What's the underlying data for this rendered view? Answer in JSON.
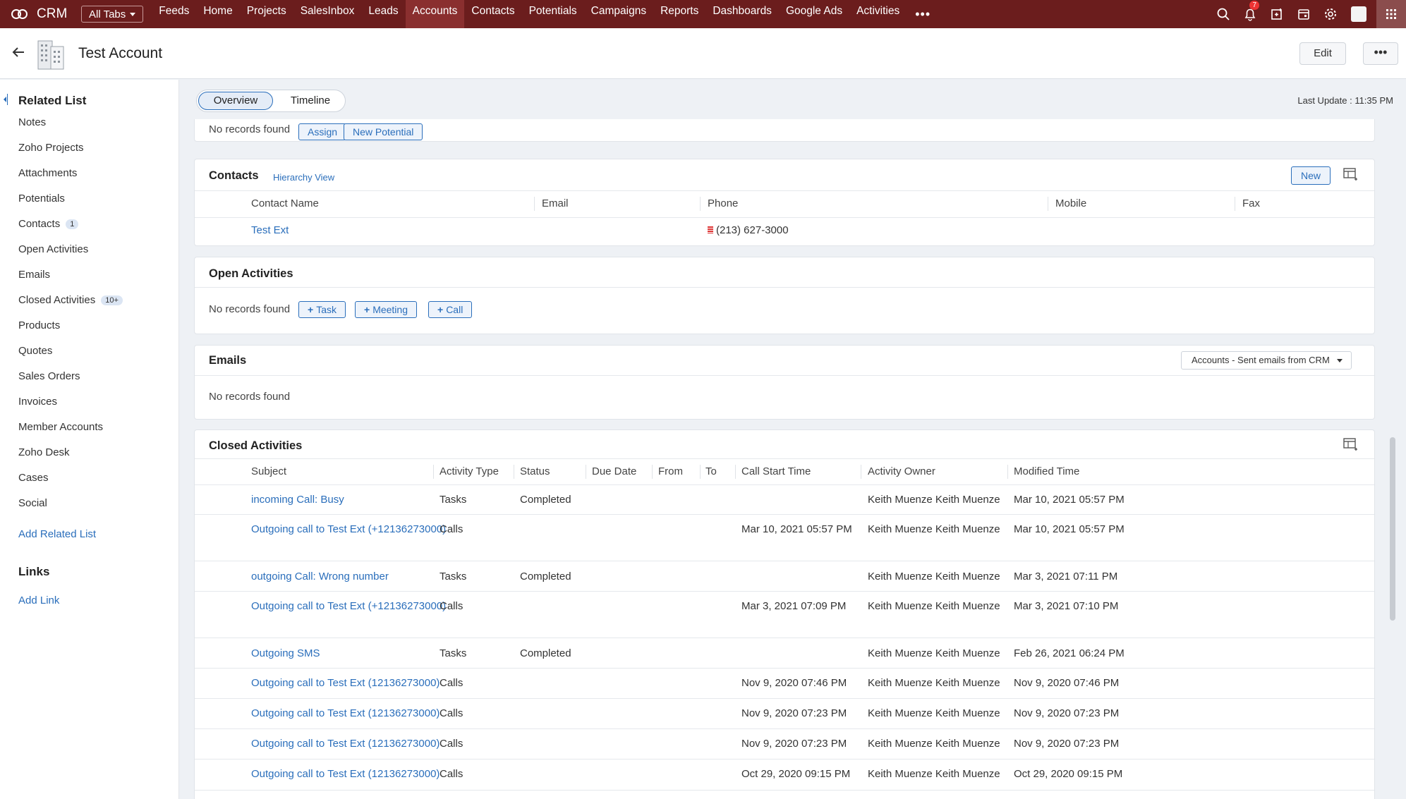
{
  "nav": {
    "brand": "CRM",
    "all_tabs": "All Tabs",
    "tabs": [
      "Feeds",
      "Home",
      "Projects",
      "SalesInbox",
      "Leads",
      "Accounts",
      "Contacts",
      "Potentials",
      "Campaigns",
      "Reports",
      "Dashboards",
      "Google Ads",
      "Activities"
    ],
    "active_tab": "Accounts",
    "more": "•••",
    "notification_count": "7",
    "icons": [
      "search-icon",
      "bell-icon",
      "add-entry-icon",
      "calendar-icon",
      "gear-icon",
      "avatar",
      "apps-grid-icon"
    ]
  },
  "record": {
    "title": "Test Account",
    "edit_label": "Edit",
    "more_label": "•••"
  },
  "sidebar": {
    "related_heading": "Related List",
    "items": [
      {
        "label": "Notes"
      },
      {
        "label": "Zoho Projects"
      },
      {
        "label": "Attachments"
      },
      {
        "label": "Potentials"
      },
      {
        "label": "Contacts",
        "count": "1"
      },
      {
        "label": "Open Activities"
      },
      {
        "label": "Emails"
      },
      {
        "label": "Closed Activities",
        "count": "10+"
      },
      {
        "label": "Products"
      },
      {
        "label": "Quotes"
      },
      {
        "label": "Sales Orders"
      },
      {
        "label": "Invoices"
      },
      {
        "label": "Member Accounts"
      },
      {
        "label": "Zoho Desk"
      },
      {
        "label": "Cases"
      },
      {
        "label": "Social"
      }
    ],
    "add_related": "Add Related List",
    "links_heading": "Links",
    "add_link": "Add Link"
  },
  "tabs": {
    "overview": "Overview",
    "timeline": "Timeline",
    "last_update": "Last Update : 11:35 PM"
  },
  "potentials_card": {
    "no_records": "No records found",
    "assign": "Assign",
    "new_potential": "New Potential"
  },
  "contacts": {
    "title": "Contacts",
    "hierarchy": "Hierarchy View",
    "new_label": "New",
    "columns": [
      "Contact Name",
      "Email",
      "Phone",
      "Mobile",
      "Fax"
    ],
    "rows": [
      {
        "name": "Test Ext",
        "email": "",
        "phone": "(213) 627-3000",
        "mobile": "",
        "fax": ""
      }
    ]
  },
  "open_activities": {
    "title": "Open Activities",
    "no_records": "No records found",
    "task": "Task",
    "meeting": "Meeting",
    "call": "Call"
  },
  "emails": {
    "title": "Emails",
    "filter": "Accounts - Sent emails from CRM",
    "no_records": "No records found"
  },
  "closed_activities": {
    "title": "Closed Activities",
    "columns": [
      "Subject",
      "Activity Type",
      "Status",
      "Due Date",
      "From",
      "To",
      "Call Start Time",
      "Activity Owner",
      "Modified Time"
    ],
    "rows": [
      {
        "subject": "incoming Call: Busy",
        "type": "Tasks",
        "status": "Completed",
        "call_start": "",
        "owner": "Keith Muenze Keith Muenze",
        "modified": "Mar 10, 2021 05:57 PM"
      },
      {
        "subject": "Outgoing call to Test Ext (+12136273000)",
        "type": "Calls",
        "status": "",
        "call_start": "Mar 10, 2021 05:57 PM",
        "owner": "Keith Muenze Keith Muenze",
        "modified": "Mar 10, 2021 05:57 PM"
      },
      {
        "subject": "outgoing Call: Wrong number",
        "type": "Tasks",
        "status": "Completed",
        "call_start": "",
        "owner": "Keith Muenze Keith Muenze",
        "modified": "Mar 3, 2021 07:11 PM"
      },
      {
        "subject": "Outgoing call to Test Ext (+12136273000)",
        "type": "Calls",
        "status": "",
        "call_start": "Mar 3, 2021 07:09 PM",
        "owner": "Keith Muenze Keith Muenze",
        "modified": "Mar 3, 2021 07:10 PM"
      },
      {
        "subject": "Outgoing SMS",
        "type": "Tasks",
        "status": "Completed",
        "call_start": "",
        "owner": "Keith Muenze Keith Muenze",
        "modified": "Feb 26, 2021 06:24 PM"
      },
      {
        "subject": "Outgoing call to Test Ext (12136273000)",
        "type": "Calls",
        "status": "",
        "call_start": "Nov 9, 2020 07:46 PM",
        "owner": "Keith Muenze Keith Muenze",
        "modified": "Nov 9, 2020 07:46 PM"
      },
      {
        "subject": "Outgoing call to Test Ext (12136273000)",
        "type": "Calls",
        "status": "",
        "call_start": "Nov 9, 2020 07:23 PM",
        "owner": "Keith Muenze Keith Muenze",
        "modified": "Nov 9, 2020 07:23 PM"
      },
      {
        "subject": "Outgoing call to Test Ext (12136273000)",
        "type": "Calls",
        "status": "",
        "call_start": "Nov 9, 2020 07:23 PM",
        "owner": "Keith Muenze Keith Muenze",
        "modified": "Nov 9, 2020 07:23 PM"
      },
      {
        "subject": "Outgoing call to Test Ext (12136273000)",
        "type": "Calls",
        "status": "",
        "call_start": "Oct 29, 2020 09:15 PM",
        "owner": "Keith Muenze Keith Muenze",
        "modified": "Oct 29, 2020 09:15 PM"
      }
    ]
  },
  "colors": {
    "nav_bg": "#6b1d1d",
    "link": "#2a6ebb"
  }
}
